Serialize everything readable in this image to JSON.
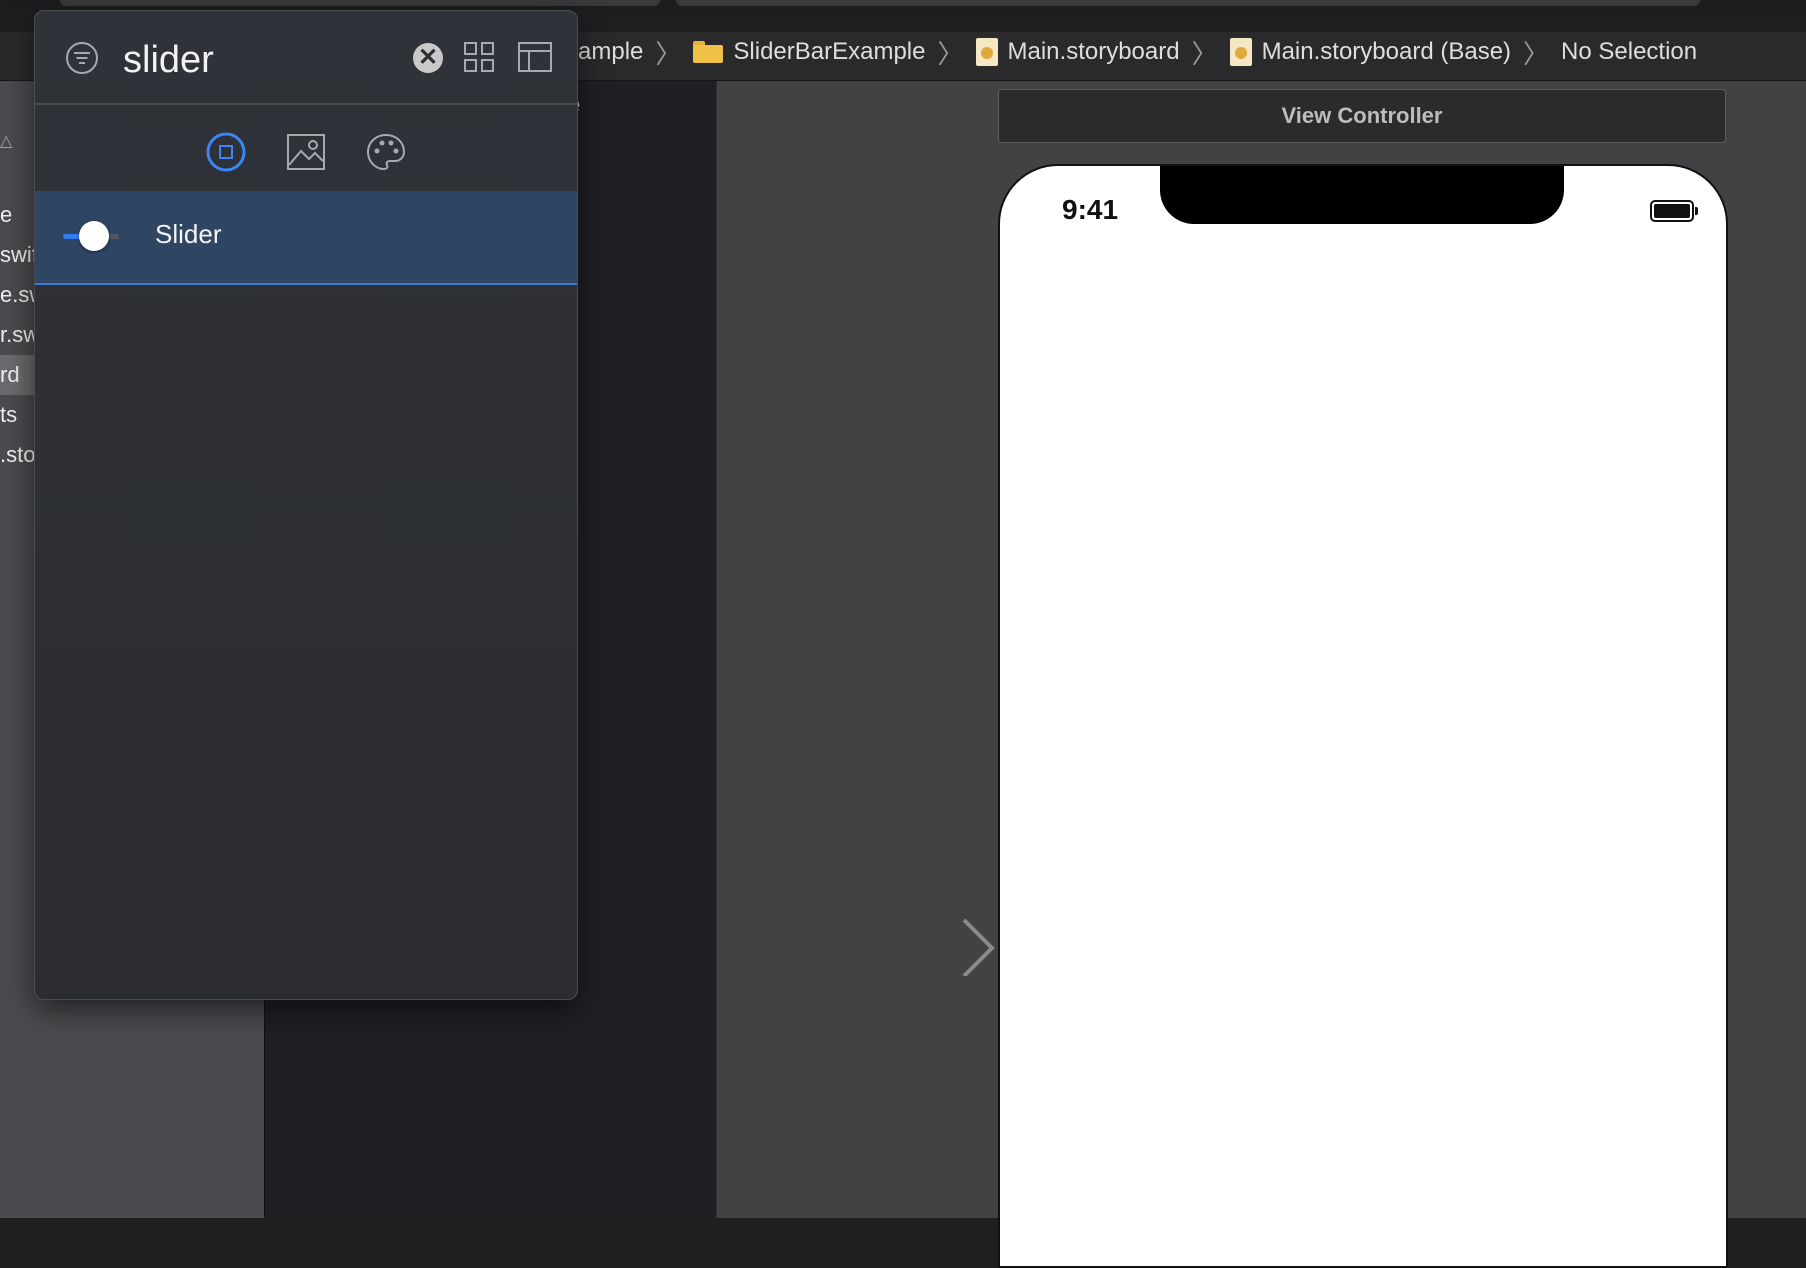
{
  "library": {
    "search_value": "slider",
    "tabs": [
      "objects",
      "media",
      "colors"
    ],
    "selected_tab": "objects",
    "results": [
      {
        "label": "Slider",
        "icon": "slider-icon",
        "selected": true
      }
    ],
    "accent_color": "#2f7cf6"
  },
  "breadcrumb": {
    "items": [
      "xample",
      "SliderBarExample",
      "Main.storyboard",
      "Main.storyboard (Base)",
      "No Selection"
    ]
  },
  "navigator": {
    "rows": [
      "e",
      "swif",
      "e.sw",
      "r.sw",
      "rd",
      "ts",
      ".sto"
    ]
  },
  "outline": {
    "partial_text": "e"
  },
  "canvas": {
    "scene_title": "View Controller",
    "status_time": "9:41"
  }
}
